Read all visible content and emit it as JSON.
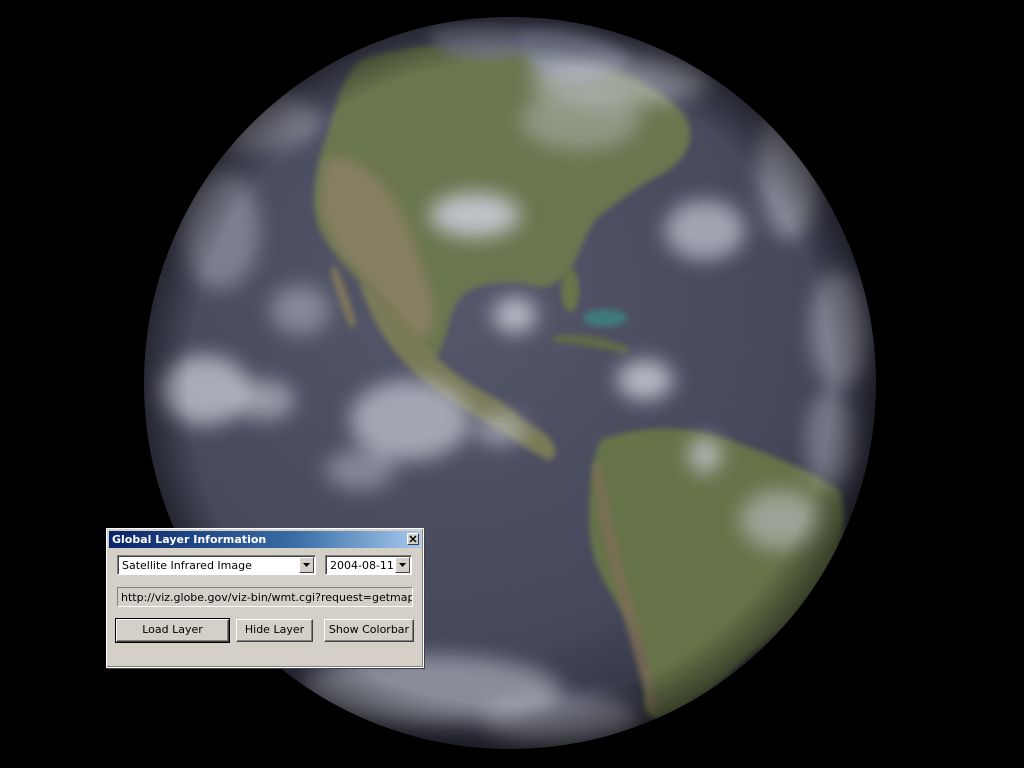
{
  "scene": {
    "background_color": "#000000",
    "globe": {
      "description_icon": "earth-globe",
      "ocean_color": "#4a4c5e",
      "land_color": "#6d7a52",
      "cloud_color": "#c8cad4"
    }
  },
  "dialog": {
    "title": "Global Layer Information",
    "close_icon": "close-icon",
    "layer_select": {
      "value": "Satellite Infrared Image"
    },
    "date_select": {
      "value": "2004-08-11"
    },
    "url_field": {
      "value": "http://viz.globe.gov/viz-bin/wmt.cgi?request=getmap&format"
    },
    "buttons": {
      "load_label": "Load Layer",
      "hide_label": "Hide Layer",
      "colorbar_label": "Show Colorbar"
    }
  }
}
